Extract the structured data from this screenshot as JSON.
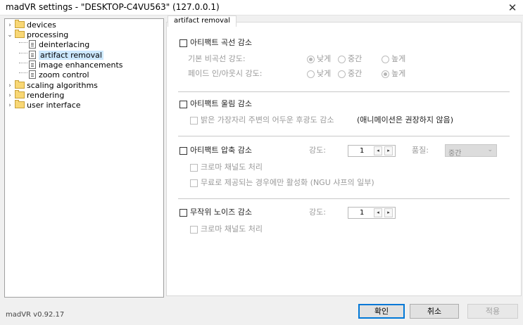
{
  "window": {
    "title": "madVR settings - \"DESKTOP-C4VU563\" (127.0.0.1)",
    "close_label": "✕"
  },
  "tree": {
    "devices": "devices",
    "processing": "processing",
    "deinterlacing": "deinterlacing",
    "artifact_removal": "artifact removal",
    "image_enhancements": "image enhancements",
    "zoom_control": "zoom control",
    "scaling_algorithms": "scaling algorithms",
    "rendering": "rendering",
    "user_interface": "user interface",
    "collapsed_chevron": "›",
    "expanded_chevron": "⌄"
  },
  "tab": {
    "label": "artifact removal"
  },
  "debanding": {
    "label": "아티팩트 곡선 감소",
    "default_strength_label": "기본 비곡선 강도:",
    "fade_strength_label": "페이드 인/아웃시 강도:",
    "low": "낮게",
    "medium": "중간",
    "high": "높게",
    "default_selected": "낮게",
    "fade_selected": "높게"
  },
  "deringing": {
    "label": "아티팩트 울림 감소",
    "sub_label": "밝은 가장자리 주변의 어두운 후광도 감소",
    "note": "(애니메이션은 권장하지 않음)"
  },
  "deblocking": {
    "label": "아티팩트 압축 감소",
    "strength_label": "강도:",
    "strength_value": "1",
    "quality_label": "품질:",
    "quality_value": "중간",
    "chroma_label": "크로마 채널도 처리",
    "free_label": "무료로 제공되는 경우에만 활성화 (NGU 샤프의 일부)"
  },
  "denoising": {
    "label": "무작위 노이즈 감소",
    "strength_label": "강도:",
    "strength_value": "1",
    "chroma_label": "크로마 채널도 처리"
  },
  "buttons": {
    "ok": "확인",
    "cancel": "취소",
    "apply": "적용"
  },
  "version": "madVR v0.92.17"
}
